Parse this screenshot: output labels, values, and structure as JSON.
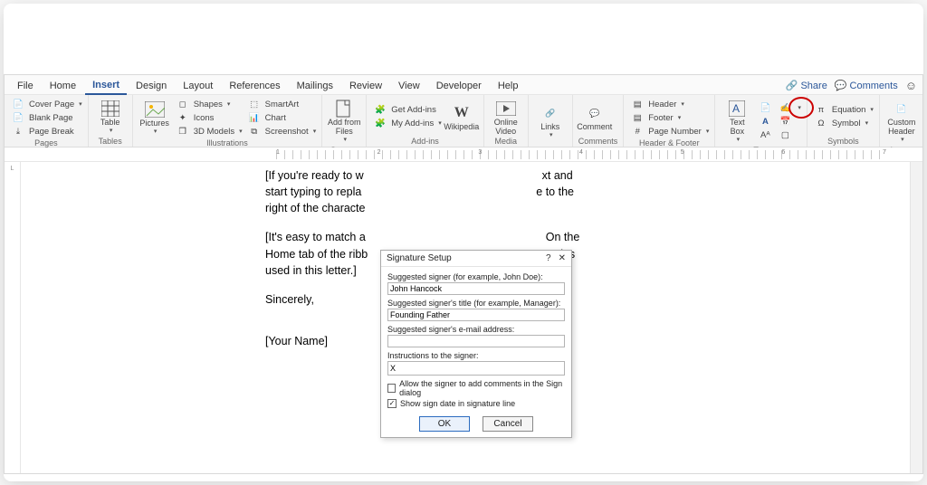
{
  "tabs": {
    "file": "File",
    "home": "Home",
    "insert": "Insert",
    "design": "Design",
    "layout": "Layout",
    "references": "References",
    "mailings": "Mailings",
    "review": "Review",
    "view": "View",
    "developer": "Developer",
    "help": "Help"
  },
  "right": {
    "share": "Share",
    "comments": "Comments"
  },
  "ribbon": {
    "pages": {
      "label": "Pages",
      "cover": "Cover Page",
      "blank": "Blank Page",
      "break": "Page Break"
    },
    "tables": {
      "label": "Tables",
      "btn": "Table"
    },
    "illus": {
      "label": "Illustrations",
      "pictures": "Pictures",
      "shapes": "Shapes",
      "icons": "Icons",
      "models": "3D Models",
      "smartart": "SmartArt",
      "chart": "Chart",
      "screenshot": "Screenshot"
    },
    "content": {
      "label": "Content",
      "addfiles": "Add from\nFiles"
    },
    "addins": {
      "label": "Add-ins",
      "get": "Get Add-ins",
      "my": "My Add-ins",
      "wiki": "Wikipedia"
    },
    "media": {
      "label": "Media",
      "video": "Online\nVideo"
    },
    "links": {
      "label": "",
      "btn": "Links"
    },
    "comments": {
      "label": "Comments",
      "btn": "Comment"
    },
    "hf": {
      "label": "Header & Footer",
      "header": "Header",
      "footer": "Footer",
      "page": "Page Number"
    },
    "text": {
      "label": "Text",
      "textbox": "Text\nBox"
    },
    "symbols": {
      "label": "Symbols",
      "eq": "Equation",
      "sym": "Symbol"
    },
    "logos": {
      "label": "Logos",
      "btn": "Custom\nHeader"
    }
  },
  "ruler_numbers": [
    "1",
    "2",
    "3",
    "4",
    "5",
    "6",
    "7"
  ],
  "document": {
    "p1a": "[If you're ready to w",
    "p1b": "xt and",
    "p2a": "start typing to repla",
    "p2b": "e to the",
    "p3": "right of the characte",
    "p4a": "[It's easy to match a",
    "p4b": "On the",
    "p5a": "Home tab of the ribb",
    "p5b": "styles",
    "p6": "used in this letter.]",
    "sincerely": "Sincerely,",
    "name": "[Your Name]"
  },
  "dialog": {
    "title": "Signature Setup",
    "label_signer": "Suggested signer (for example, John Doe):",
    "val_signer": "John Hancock",
    "label_title": "Suggested signer's title (for example, Manager):",
    "val_title": "Founding Father",
    "label_email": "Suggested signer's e-mail address:",
    "val_email": "",
    "label_instr": "Instructions to the signer:",
    "val_instr": "X",
    "chk1": "Allow the signer to add comments in the Sign dialog",
    "chk2": "Show sign date in signature line",
    "ok": "OK",
    "cancel": "Cancel"
  }
}
